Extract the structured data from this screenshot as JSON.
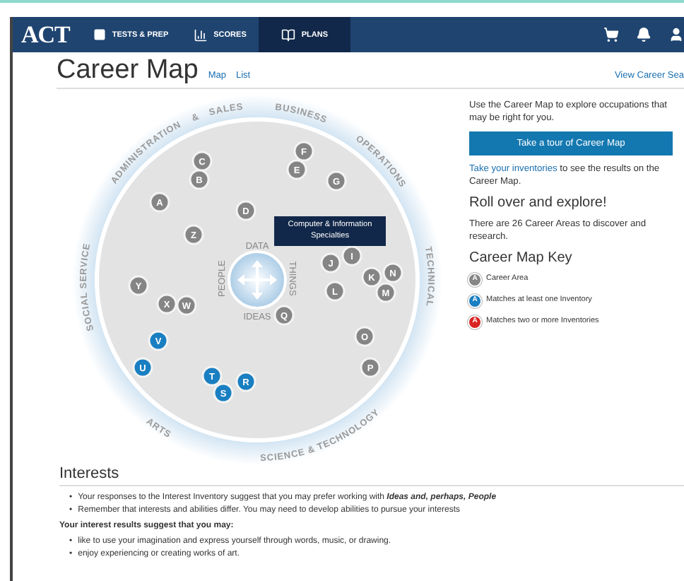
{
  "nav": {
    "logo": "ACT",
    "items": [
      {
        "label": "TESTS & PREP",
        "kind": "tests",
        "selected": false
      },
      {
        "label": "SCORES",
        "kind": "scores",
        "selected": false
      },
      {
        "label": "PLANS",
        "kind": "plans",
        "selected": true
      }
    ]
  },
  "header": {
    "title": "Career Map",
    "views": [
      "Map",
      "List"
    ],
    "search_link": "View Career Sea"
  },
  "map": {
    "sectors": [
      {
        "words": [
          "ADMINISTRATION",
          "&",
          "SALES"
        ]
      },
      {
        "words": [
          "BUSINESS",
          "OPERATIONS"
        ]
      },
      {
        "words": [
          "TECHNICAL"
        ]
      },
      {
        "words": [
          "SCIENCE & TECHNOLOGY"
        ]
      },
      {
        "words": [
          "ARTS"
        ]
      },
      {
        "words": [
          "SOCIAL SERVICE"
        ]
      }
    ],
    "axes": [
      "DATA",
      "THINGS",
      "IDEAS",
      "PEOPLE"
    ],
    "nodes": [
      {
        "letter": "F",
        "color": "#858585"
      },
      {
        "letter": "C",
        "color": "#858585"
      },
      {
        "letter": "E",
        "color": "#858585"
      },
      {
        "letter": "B",
        "color": "#858585"
      },
      {
        "letter": "G",
        "color": "#858585"
      },
      {
        "letter": "A",
        "color": "#858585"
      },
      {
        "letter": "D",
        "color": "#858585"
      },
      {
        "letter": "Z",
        "color": "#858585"
      },
      {
        "letter": "I",
        "color": "#858585"
      },
      {
        "letter": "J",
        "color": "#858585"
      },
      {
        "letter": "N",
        "color": "#858585"
      },
      {
        "letter": "K",
        "color": "#858585"
      },
      {
        "letter": "Y",
        "color": "#858585"
      },
      {
        "letter": "L",
        "color": "#858585"
      },
      {
        "letter": "M",
        "color": "#858585"
      },
      {
        "letter": "X",
        "color": "#858585"
      },
      {
        "letter": "W",
        "color": "#858585"
      },
      {
        "letter": "Q",
        "color": "#858585"
      },
      {
        "letter": "O",
        "color": "#858585"
      },
      {
        "letter": "V",
        "color": "#1a7fc1"
      },
      {
        "letter": "U",
        "color": "#1a7fc1"
      },
      {
        "letter": "P",
        "color": "#858585"
      },
      {
        "letter": "T",
        "color": "#1a7fc1"
      },
      {
        "letter": "R",
        "color": "#1a7fc1"
      },
      {
        "letter": "S",
        "color": "#1a7fc1"
      }
    ],
    "tooltip": "Computer & Information Specialties"
  },
  "sidebar": {
    "intro": "Use the Career Map to explore occupations that may be right for you.",
    "tour_button": "Take a tour of Career Map",
    "inventories_link": "Take your inventories",
    "inventories_text": "to see the results on the Career Map.",
    "explore_heading": "Roll over and explore!",
    "areas_text": "There are 26 Career Areas to discover and research.",
    "key_heading": "Career Map Key",
    "key": [
      {
        "letter": "A",
        "color": "#858585",
        "label": "Career Area"
      },
      {
        "letter": "A",
        "color": "#1a7fc1",
        "label": "Matches at least one Inventory"
      },
      {
        "letter": "A",
        "color": "#d92323",
        "label": "Matches two or more Inventories"
      }
    ]
  },
  "interests": {
    "heading": "Interests",
    "bullet_mark": "•",
    "bullets": [
      "Your responses to the Interest Inventory suggest that you may prefer working with **Ideas and, perhaps, People**",
      "Remember that interests and abilities differ. You may need to develop abilities to pursue your interests"
    ],
    "results_heading": "Your interest results suggest that you may:",
    "results": [
      "like to use your imagination and express yourself through words, music, or drawing.",
      "enjoy experiencing or creating works of art."
    ]
  }
}
